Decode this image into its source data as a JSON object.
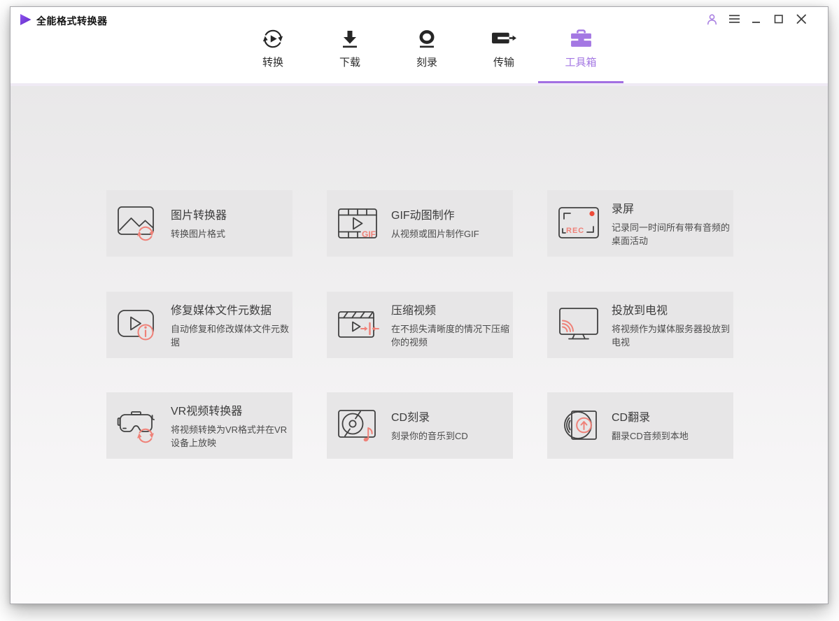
{
  "app": {
    "title": "全能格式转换器"
  },
  "titlebar": {
    "icons": [
      "account-icon",
      "menu-icon",
      "minimize-icon",
      "maximize-icon",
      "close-icon"
    ]
  },
  "nav": {
    "tabs": [
      {
        "id": "convert",
        "label": "转换",
        "active": false
      },
      {
        "id": "download",
        "label": "下载",
        "active": false
      },
      {
        "id": "burn",
        "label": "刻录",
        "active": false
      },
      {
        "id": "transfer",
        "label": "传输",
        "active": false
      },
      {
        "id": "toolbox",
        "label": "工具箱",
        "active": true
      }
    ]
  },
  "icons": {
    "gif_label": "GIF",
    "rec_label": "REC"
  },
  "toolbox": {
    "cards": [
      {
        "id": "image-converter",
        "title": "图片转换器",
        "subtitle": "转换图片格式"
      },
      {
        "id": "gif-maker",
        "title": "GIF动图制作",
        "subtitle": "从视频或图片制作GIF"
      },
      {
        "id": "screen-recorder",
        "title": "录屏",
        "subtitle": "记录同一时间所有带有音频的\n桌面活动"
      },
      {
        "id": "fix-metadata",
        "title": "修复媒体文件元数据",
        "subtitle": "自动修复和修改媒体文件元数\n据"
      },
      {
        "id": "video-compressor",
        "title": "压缩视频",
        "subtitle": "在不损失清晰度的情况下压缩\n你的视频"
      },
      {
        "id": "cast-to-tv",
        "title": "投放到电视",
        "subtitle": "将视频作为媒体服务器投放到\n电视"
      },
      {
        "id": "vr-converter",
        "title": "VR视频转换器",
        "subtitle": "将视频转换为VR格式并在VR\n设备上放映"
      },
      {
        "id": "cd-burner",
        "title": "CD刻录",
        "subtitle": "刻录你的音乐到CD"
      },
      {
        "id": "cd-ripper",
        "title": "CD翻录",
        "subtitle": "翻录CD音频到本地"
      }
    ]
  },
  "colors": {
    "accent_purple": "#a478e3",
    "accent_coral": "#ef8178",
    "record_red": "#ee4a38",
    "icon_ink": "#414141"
  }
}
